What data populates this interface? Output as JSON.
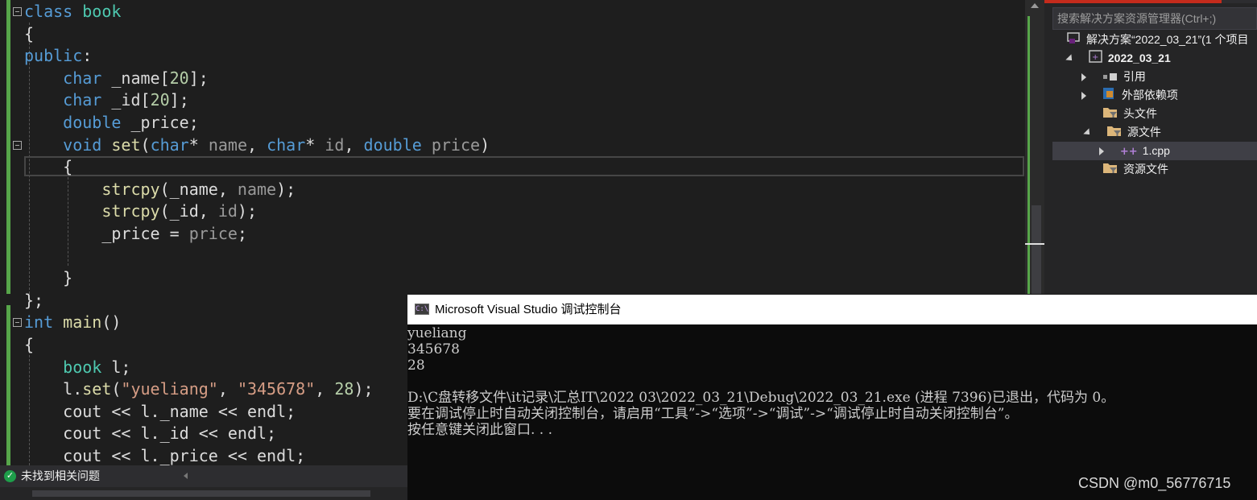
{
  "editor": {
    "lines": [
      [
        {
          "t": "class",
          "c": "kw"
        },
        {
          "t": " ",
          "c": "plain"
        },
        {
          "t": "book",
          "c": "ty"
        }
      ],
      [
        {
          "t": "{",
          "c": "plain"
        }
      ],
      [
        {
          "t": "public",
          "c": "kw"
        },
        {
          "t": ":",
          "c": "plain"
        }
      ],
      [
        {
          "t": "    ",
          "c": "plain"
        },
        {
          "t": "char",
          "c": "kw"
        },
        {
          "t": " _name[",
          "c": "var"
        },
        {
          "t": "20",
          "c": "num"
        },
        {
          "t": "];",
          "c": "plain"
        }
      ],
      [
        {
          "t": "    ",
          "c": "plain"
        },
        {
          "t": "char",
          "c": "kw"
        },
        {
          "t": " _id[",
          "c": "var"
        },
        {
          "t": "20",
          "c": "num"
        },
        {
          "t": "];",
          "c": "plain"
        }
      ],
      [
        {
          "t": "    ",
          "c": "plain"
        },
        {
          "t": "double",
          "c": "kw"
        },
        {
          "t": " _price;",
          "c": "var"
        }
      ],
      [
        {
          "t": "    ",
          "c": "plain"
        },
        {
          "t": "void",
          "c": "kw"
        },
        {
          "t": " ",
          "c": "plain"
        },
        {
          "t": "set",
          "c": "fn"
        },
        {
          "t": "(",
          "c": "plain"
        },
        {
          "t": "char",
          "c": "kw"
        },
        {
          "t": "* ",
          "c": "plain"
        },
        {
          "t": "name",
          "c": "param"
        },
        {
          "t": ", ",
          "c": "plain"
        },
        {
          "t": "char",
          "c": "kw"
        },
        {
          "t": "* ",
          "c": "plain"
        },
        {
          "t": "id",
          "c": "param"
        },
        {
          "t": ", ",
          "c": "plain"
        },
        {
          "t": "double",
          "c": "kw"
        },
        {
          "t": " ",
          "c": "plain"
        },
        {
          "t": "price",
          "c": "param"
        },
        {
          "t": ")",
          "c": "plain"
        }
      ],
      [
        {
          "t": "    {",
          "c": "plain"
        }
      ],
      [
        {
          "t": "        ",
          "c": "plain"
        },
        {
          "t": "strcpy",
          "c": "fn"
        },
        {
          "t": "(_name, ",
          "c": "plain"
        },
        {
          "t": "name",
          "c": "param"
        },
        {
          "t": ");",
          "c": "plain"
        }
      ],
      [
        {
          "t": "        ",
          "c": "plain"
        },
        {
          "t": "strcpy",
          "c": "fn"
        },
        {
          "t": "(_id, ",
          "c": "plain"
        },
        {
          "t": "id",
          "c": "param"
        },
        {
          "t": ");",
          "c": "plain"
        }
      ],
      [
        {
          "t": "        _price = ",
          "c": "plain"
        },
        {
          "t": "price",
          "c": "param"
        },
        {
          "t": ";",
          "c": "plain"
        }
      ],
      [
        {
          "t": "",
          "c": "plain"
        }
      ],
      [
        {
          "t": "    }",
          "c": "plain"
        }
      ],
      [
        {
          "t": "};",
          "c": "plain"
        }
      ],
      [
        {
          "t": "int",
          "c": "kw"
        },
        {
          "t": " ",
          "c": "plain"
        },
        {
          "t": "main",
          "c": "fn"
        },
        {
          "t": "()",
          "c": "plain"
        }
      ],
      [
        {
          "t": "{",
          "c": "plain"
        }
      ],
      [
        {
          "t": "    ",
          "c": "plain"
        },
        {
          "t": "book",
          "c": "ty"
        },
        {
          "t": " l;",
          "c": "plain"
        }
      ],
      [
        {
          "t": "    l.",
          "c": "plain"
        },
        {
          "t": "set",
          "c": "fn"
        },
        {
          "t": "(",
          "c": "plain"
        },
        {
          "t": "\"yueliang\"",
          "c": "str"
        },
        {
          "t": ", ",
          "c": "plain"
        },
        {
          "t": "\"345678\"",
          "c": "str"
        },
        {
          "t": ", ",
          "c": "plain"
        },
        {
          "t": "28",
          "c": "num"
        },
        {
          "t": ");",
          "c": "plain"
        }
      ],
      [
        {
          "t": "    cout << l._name << endl;",
          "c": "plain"
        }
      ],
      [
        {
          "t": "    cout << l._id << endl;",
          "c": "plain"
        }
      ],
      [
        {
          "t": "    cout << l._price << endl;",
          "c": "plain"
        }
      ]
    ]
  },
  "solution_explorer": {
    "search_placeholder": "搜索解决方案资源管理器(Ctrl+;)",
    "solution_label": "解决方案“2022_03_21”(1 个项目",
    "project_label": "2022_03_21",
    "items": {
      "references": "引用",
      "external_deps": "外部依赖项",
      "header_files": "头文件",
      "source_files": "源文件",
      "source_file_1": "1.cpp",
      "resource_files": "资源文件"
    }
  },
  "console": {
    "title": "Microsoft Visual Studio 调试控制台",
    "icon_text": "C:\\",
    "output": [
      "yueliang",
      "345678",
      "28",
      "",
      "D:\\C盘转移文件\\it记录\\汇总IT\\2022 03\\2022_03_21\\Debug\\2022_03_21.exe (进程 7396)已退出，代码为 0。",
      "要在调试停止时自动关闭控制台，请启用“工具”->“选项”->“调试”->“调试停止时自动关闭控制台”。",
      "按任意键关闭此窗口. . ."
    ]
  },
  "statusbar": {
    "issues_text": "未找到相关问题"
  },
  "watermark": "CSDN @m0_56776715"
}
